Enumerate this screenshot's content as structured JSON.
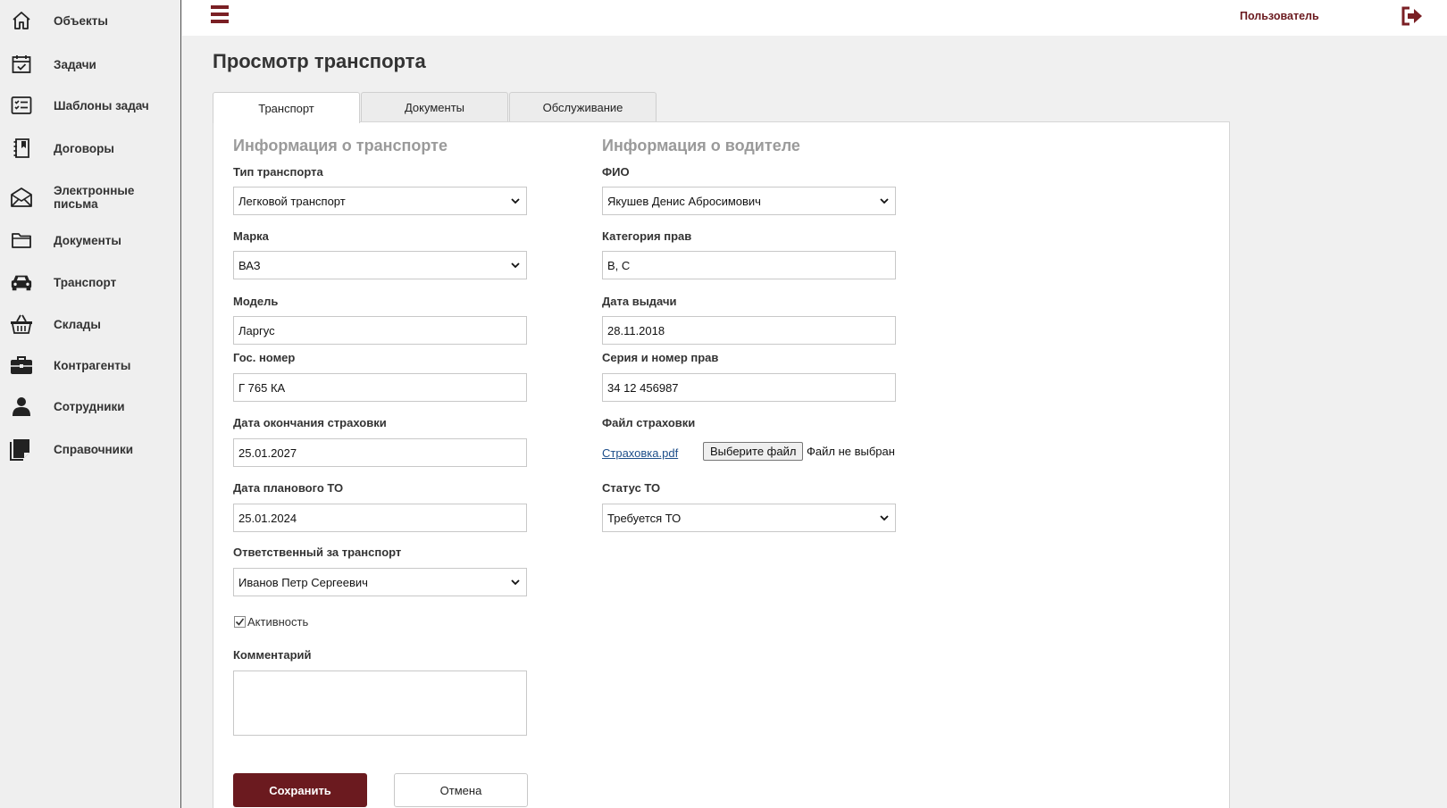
{
  "sidebar": {
    "items": [
      {
        "label": "Объекты",
        "icon": "home-icon"
      },
      {
        "label": "Задачи",
        "icon": "calendar-check-icon"
      },
      {
        "label": "Шаблоны задач",
        "icon": "checklist-icon"
      },
      {
        "label": "Договоры",
        "icon": "contract-book-icon"
      },
      {
        "label": "Электронные письма",
        "icon": "envelope-icon"
      },
      {
        "label": "Документы",
        "icon": "folder-icon"
      },
      {
        "label": "Транспорт",
        "icon": "car-icon"
      },
      {
        "label": "Склады",
        "icon": "basket-icon"
      },
      {
        "label": "Контрагенты",
        "icon": "briefcase-icon"
      },
      {
        "label": "Сотрудники",
        "icon": "person-icon"
      },
      {
        "label": "Справочники",
        "icon": "note-icon"
      }
    ]
  },
  "header": {
    "user_label": "Пользователь",
    "accent_color": "#6b1a1f"
  },
  "page": {
    "title": "Просмотр транспорта"
  },
  "tabs": [
    {
      "label": "Транспорт",
      "active": true
    },
    {
      "label": "Документы",
      "active": false
    },
    {
      "label": "Обслуживание",
      "active": false
    }
  ],
  "vehicle": {
    "section_title": "Информация о транспорте",
    "type_label": "Тип транспорта",
    "type_value": "Легковой транспорт",
    "brand_label": "Марка",
    "brand_value": "ВАЗ",
    "model_label": "Модель",
    "model_value": "Ларгус",
    "plate_label": "Гос. номер",
    "plate_value": "Г 765 КА",
    "insurance_end_label": "Дата окончания страховки",
    "insurance_end_value": "25.01.2027",
    "planned_to_label": "Дата планового ТО",
    "planned_to_value": "25.01.2024",
    "responsible_label": "Ответственный за транспорт",
    "responsible_value": "Иванов Петр Сергеевич",
    "active_label": "Активность",
    "active_checked": true,
    "comment_label": "Комментарий",
    "comment_value": ""
  },
  "driver": {
    "section_title": "Информация о водителе",
    "name_label": "ФИО",
    "name_value": "Якушев Денис Абросимович",
    "license_category_label": "Категория прав",
    "license_category_value": "B, C",
    "issue_date_label": "Дата выдачи",
    "issue_date_value": "28.11.2018",
    "license_number_label": "Серия и номер прав",
    "license_number_value": "34 12 456987",
    "insurance_file_label": "Файл страховки",
    "insurance_file_link": "Страховка.pdf",
    "choose_file_label": "Выберите файл",
    "no_file_label": "Файл не выбран",
    "to_status_label": "Статус ТО",
    "to_status_value": "Требуется ТО"
  },
  "actions": {
    "save_label": "Сохранить",
    "cancel_label": "Отмена"
  }
}
